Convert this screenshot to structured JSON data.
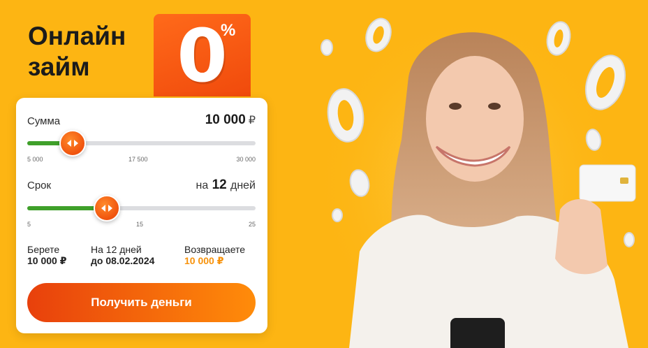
{
  "headline": {
    "line1": "Онлайн",
    "line2": "займ"
  },
  "promo": {
    "digit": "0",
    "percent": "%"
  },
  "amount": {
    "label": "Сумма",
    "value": "10 000",
    "currency": "₽",
    "ticks": [
      "5 000",
      "17 500",
      "30 000"
    ],
    "level": 0.2
  },
  "term": {
    "label": "Срок",
    "prefix": "на",
    "value": "12",
    "unit": "дней",
    "ticks": [
      "5",
      "15",
      "25"
    ],
    "level": 0.35
  },
  "summary": {
    "take_label": "Берете",
    "take_value": "10 000 ₽",
    "term_label": "На 12 дней",
    "term_value": "до 08.02.2024",
    "return_label": "Возвращаете",
    "return_value": "10 000 ₽"
  },
  "cta": {
    "label": "Получить деньги"
  },
  "colors": {
    "background": "#FDB513",
    "accent": "#F04A0C",
    "slider_fill": "#3FA02A",
    "return_value": "#F7920B"
  }
}
